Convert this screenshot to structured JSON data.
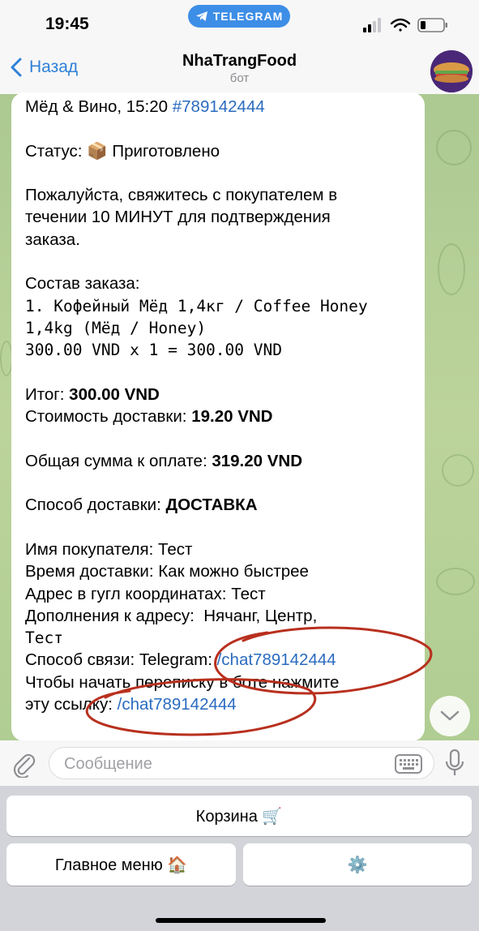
{
  "status_bar": {
    "time": "19:45",
    "app_pill": "TELEGRAM"
  },
  "header": {
    "back_label": "Назад",
    "title": "NhaTrangFood",
    "subtitle": "бот"
  },
  "message": {
    "line1_prefix": "Мёд & Вино, 15:20 ",
    "line1_link": "#789142444",
    "status": "Статус: 📦 Приготовлено",
    "notice": [
      "Пожалуйста, свяжитесь с покупателем в",
      "течении 10 МИНУТ для подтверждения",
      "заказа."
    ],
    "order_heading": "Состав заказа:",
    "order_items": [
      "1. Кофейный Мёд 1,4кг / Coffee Honey",
      "1,4kg (Мёд / Honey)",
      "300.00 VND x 1 = 300.00 VND"
    ],
    "total_label": "Итог: ",
    "total_value": "300.00 VND",
    "delivery_cost_label": "Стоимость доставки: ",
    "delivery_cost_value": "19.20 VND",
    "grand_total_label": "Общая сумма к оплате: ",
    "grand_total_value": "319.20 VND",
    "delivery_method_label": "Способ доставки: ",
    "delivery_method_value": "ДОСТАВКА",
    "buyer_name": "Имя покупателя: Тест",
    "delivery_time": "Время доставки: Как можно быстрее",
    "address": "Адрес в гугл координатах: Тест",
    "address_extra_1": "Дополнения к адресу:  Нячанг, Центр,",
    "address_extra_2": "Тест",
    "contact_label": "Способ связи: Telegram: ",
    "contact_link": "/chat789142444",
    "chat_hint": "Чтобы начать переписку в боте нажмите",
    "chat_hint_prefix": "эту ссылку: ",
    "chat_hint_link": "/chat789142444"
  },
  "input": {
    "placeholder": "Сообщение"
  },
  "keyboard": {
    "cart": "Корзина 🛒",
    "main_menu": "Главное меню 🏠",
    "settings": "⚙️"
  },
  "colors": {
    "link": "#2a6bbf",
    "accent": "#2f80d8",
    "annotation": "#b8301e"
  }
}
